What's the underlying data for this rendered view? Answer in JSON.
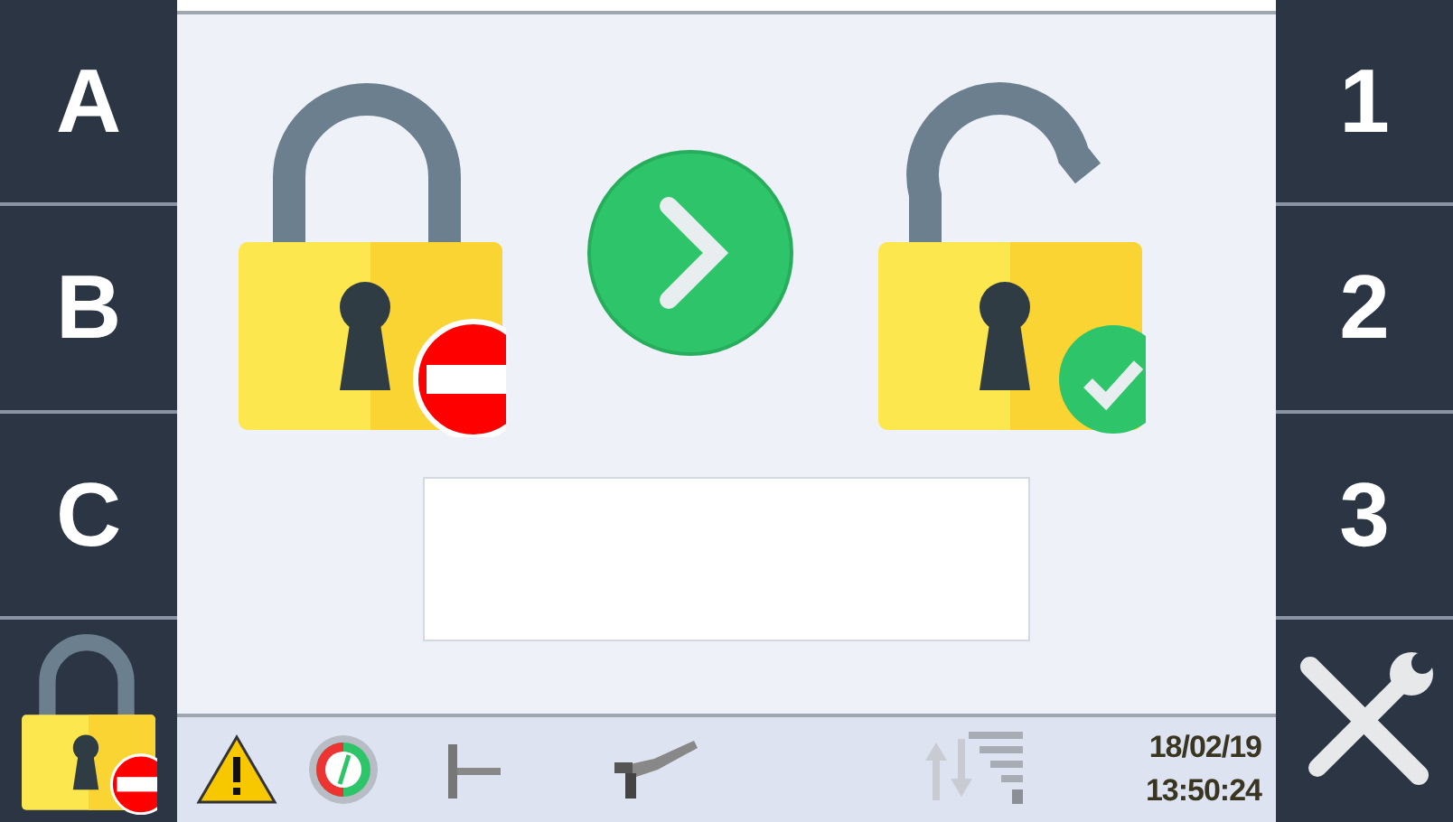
{
  "left_keys": [
    {
      "kind": "letter",
      "label": "A"
    },
    {
      "kind": "letter",
      "label": "B"
    },
    {
      "kind": "letter",
      "label": "C"
    },
    {
      "kind": "lock"
    }
  ],
  "right_keys": [
    {
      "kind": "letter",
      "label": "1"
    },
    {
      "kind": "letter",
      "label": "2"
    },
    {
      "kind": "letter",
      "label": "3"
    },
    {
      "kind": "tools"
    }
  ],
  "status_bar": {
    "date": "18/02/19",
    "time": "13:50:24"
  }
}
